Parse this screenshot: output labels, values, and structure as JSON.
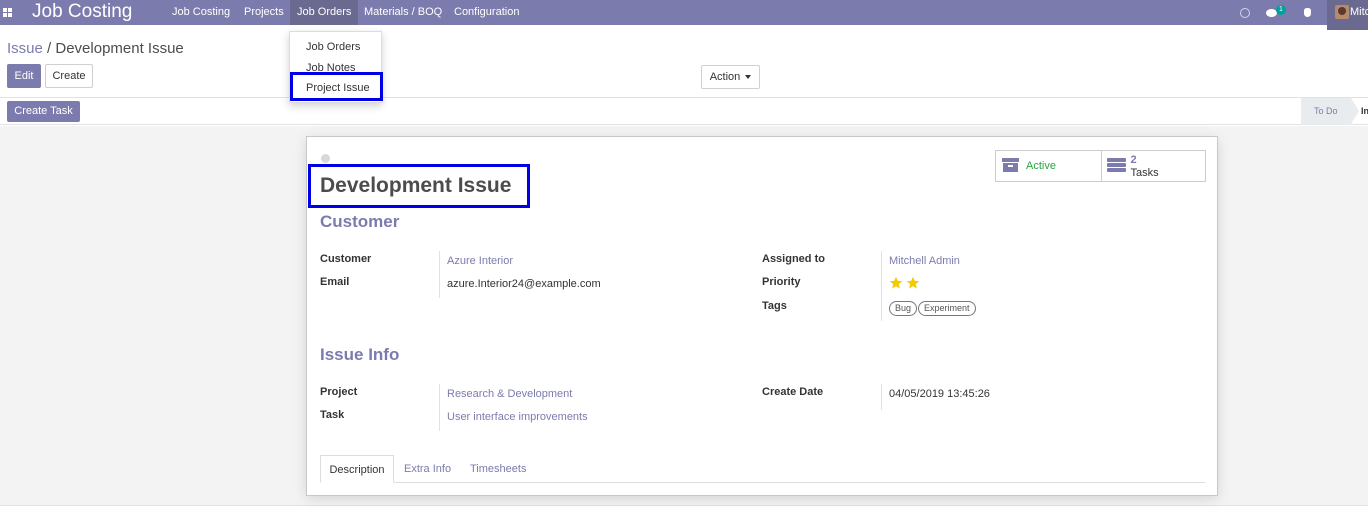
{
  "navbar": {
    "app_title": "Job Costing",
    "menu": [
      "Job Costing",
      "Projects",
      "Job Orders",
      "Materials / BOQ",
      "Configuration"
    ],
    "chat_badge": "1",
    "user_name": "Mitc"
  },
  "dropdown": {
    "items": [
      "Job Orders",
      "Job Notes",
      "Project Issue"
    ]
  },
  "breadcrumb": {
    "parent": "Issue",
    "separator": "/",
    "current": "Development Issue"
  },
  "buttons": {
    "edit": "Edit",
    "create": "Create",
    "action": "Action",
    "create_task": "Create Task"
  },
  "statusbar": {
    "stages": [
      "To Do",
      "In"
    ]
  },
  "record": {
    "title": "Development Issue",
    "smart_buttons": {
      "active_label": "Active",
      "tasks_count": "2",
      "tasks_label": "Tasks"
    },
    "customer_section": {
      "title": "Customer",
      "customer_label": "Customer",
      "customer_value": "Azure Interior",
      "email_label": "Email",
      "email_value": "azure.Interior24@example.com",
      "assigned_label": "Assigned to",
      "assigned_value": "Mitchell Admin",
      "priority_label": "Priority",
      "priority_stars": 2,
      "tags_label": "Tags",
      "tags": [
        "Bug",
        "Experiment"
      ]
    },
    "issue_section": {
      "title": "Issue Info",
      "project_label": "Project",
      "project_value": "Research & Development",
      "task_label": "Task",
      "task_value": "User interface improvements",
      "create_date_label": "Create Date",
      "create_date_value": "04/05/2019 13:45:26"
    },
    "tabs": [
      "Description",
      "Extra Info",
      "Timesheets"
    ]
  },
  "colors": {
    "brand": "#7c7bad",
    "highlight": "#0000e6",
    "active_green": "#28a745",
    "star": "#f3cc00"
  }
}
